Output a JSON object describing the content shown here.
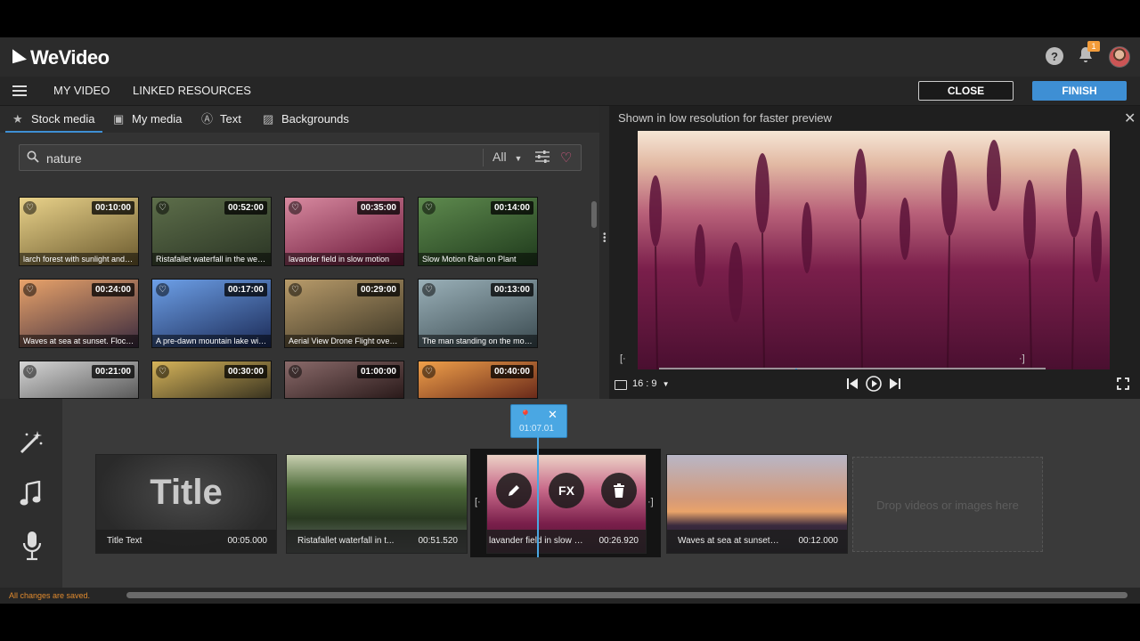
{
  "app": {
    "logo_text": "WeVideo",
    "notification_count": "1"
  },
  "menubar": {
    "my_video": "MY VIDEO",
    "linked_resources": "LINKED RESOURCES",
    "close": "CLOSE",
    "finish": "FINISH"
  },
  "media": {
    "tabs": [
      "Stock media",
      "My media",
      "Text",
      "Backgrounds"
    ],
    "search_value": "nature",
    "filter_value": "All",
    "thumbs": [
      {
        "duration": "00:10:00",
        "title": "larch forest with sunlight and s...",
        "c1": "#e9d28a",
        "c2": "#6b5a2e"
      },
      {
        "duration": "00:52:00",
        "title": "Ristafallet waterfall in the west...",
        "c1": "#5d6e4a",
        "c2": "#2a3424"
      },
      {
        "duration": "00:35:00",
        "title": "lavander field in slow motion",
        "c1": "#d88aa0",
        "c2": "#6a1638"
      },
      {
        "duration": "00:14:00",
        "title": "Slow Motion Rain on Plant",
        "c1": "#5e8a4e",
        "c2": "#1f3a1c"
      },
      {
        "duration": "00:24:00",
        "title": "Waves at sea at sunset. Flocks ...",
        "c1": "#e9a36a",
        "c2": "#3a2a3e"
      },
      {
        "duration": "00:17:00",
        "title": "A pre-dawn mountain lake wit...",
        "c1": "#6da0e8",
        "c2": "#1b2a56"
      },
      {
        "duration": "00:29:00",
        "title": "Aerial View Drone Flight over f...",
        "c1": "#b89b6a",
        "c2": "#3a3424"
      },
      {
        "duration": "00:13:00",
        "title": "The man standing on the moun...",
        "c1": "#9ab0b8",
        "c2": "#3a4a50"
      },
      {
        "duration": "00:21:00",
        "title": "",
        "c1": "#d6d6d6",
        "c2": "#5a5a5a"
      },
      {
        "duration": "00:30:00",
        "title": "",
        "c1": "#d6b45a",
        "c2": "#3a3420"
      },
      {
        "duration": "01:00:00",
        "title": "",
        "c1": "#8a6a6a",
        "c2": "#2a1a1a"
      },
      {
        "duration": "00:40:00",
        "title": "",
        "c1": "#f0a04a",
        "c2": "#6a2a1a"
      }
    ]
  },
  "preview": {
    "note": "Shown in low resolution for faster preview",
    "aspect": "16 : 9"
  },
  "timeline": {
    "clips": [
      {
        "name": "Title Text",
        "duration": "00:05.000",
        "big_text": "Title"
      },
      {
        "name": "Ristafallet waterfall in t...",
        "duration": "00:51.520"
      },
      {
        "name": "lavander field in slow m...",
        "duration": "00:26.920"
      },
      {
        "name": "Waves at sea at sunset. ...",
        "duration": "00:12.000"
      }
    ],
    "drop_text": "Drop videos or images here",
    "playhead_time": "01:07.01",
    "fx_label": "FX"
  },
  "footer": {
    "saved": "All changes are saved."
  }
}
